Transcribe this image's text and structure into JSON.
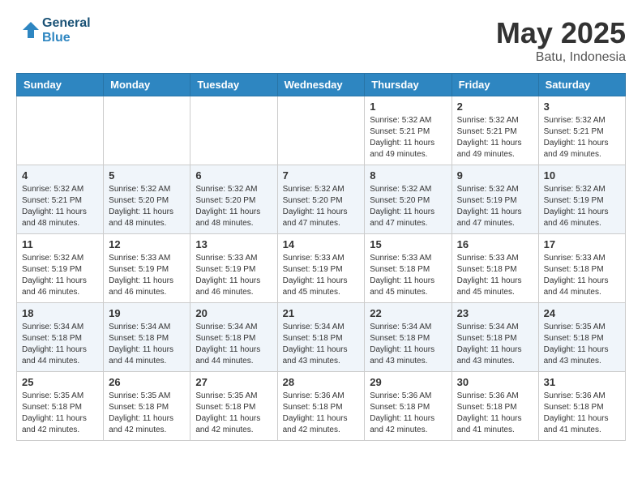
{
  "header": {
    "logo_line1": "General",
    "logo_line2": "Blue",
    "month": "May 2025",
    "location": "Batu, Indonesia"
  },
  "weekdays": [
    "Sunday",
    "Monday",
    "Tuesday",
    "Wednesday",
    "Thursday",
    "Friday",
    "Saturday"
  ],
  "weeks": [
    [
      {
        "day": "",
        "info": ""
      },
      {
        "day": "",
        "info": ""
      },
      {
        "day": "",
        "info": ""
      },
      {
        "day": "",
        "info": ""
      },
      {
        "day": "1",
        "info": "Sunrise: 5:32 AM\nSunset: 5:21 PM\nDaylight: 11 hours\nand 49 minutes."
      },
      {
        "day": "2",
        "info": "Sunrise: 5:32 AM\nSunset: 5:21 PM\nDaylight: 11 hours\nand 49 minutes."
      },
      {
        "day": "3",
        "info": "Sunrise: 5:32 AM\nSunset: 5:21 PM\nDaylight: 11 hours\nand 49 minutes."
      }
    ],
    [
      {
        "day": "4",
        "info": "Sunrise: 5:32 AM\nSunset: 5:21 PM\nDaylight: 11 hours\nand 48 minutes."
      },
      {
        "day": "5",
        "info": "Sunrise: 5:32 AM\nSunset: 5:20 PM\nDaylight: 11 hours\nand 48 minutes."
      },
      {
        "day": "6",
        "info": "Sunrise: 5:32 AM\nSunset: 5:20 PM\nDaylight: 11 hours\nand 48 minutes."
      },
      {
        "day": "7",
        "info": "Sunrise: 5:32 AM\nSunset: 5:20 PM\nDaylight: 11 hours\nand 47 minutes."
      },
      {
        "day": "8",
        "info": "Sunrise: 5:32 AM\nSunset: 5:20 PM\nDaylight: 11 hours\nand 47 minutes."
      },
      {
        "day": "9",
        "info": "Sunrise: 5:32 AM\nSunset: 5:19 PM\nDaylight: 11 hours\nand 47 minutes."
      },
      {
        "day": "10",
        "info": "Sunrise: 5:32 AM\nSunset: 5:19 PM\nDaylight: 11 hours\nand 46 minutes."
      }
    ],
    [
      {
        "day": "11",
        "info": "Sunrise: 5:32 AM\nSunset: 5:19 PM\nDaylight: 11 hours\nand 46 minutes."
      },
      {
        "day": "12",
        "info": "Sunrise: 5:33 AM\nSunset: 5:19 PM\nDaylight: 11 hours\nand 46 minutes."
      },
      {
        "day": "13",
        "info": "Sunrise: 5:33 AM\nSunset: 5:19 PM\nDaylight: 11 hours\nand 46 minutes."
      },
      {
        "day": "14",
        "info": "Sunrise: 5:33 AM\nSunset: 5:19 PM\nDaylight: 11 hours\nand 45 minutes."
      },
      {
        "day": "15",
        "info": "Sunrise: 5:33 AM\nSunset: 5:18 PM\nDaylight: 11 hours\nand 45 minutes."
      },
      {
        "day": "16",
        "info": "Sunrise: 5:33 AM\nSunset: 5:18 PM\nDaylight: 11 hours\nand 45 minutes."
      },
      {
        "day": "17",
        "info": "Sunrise: 5:33 AM\nSunset: 5:18 PM\nDaylight: 11 hours\nand 44 minutes."
      }
    ],
    [
      {
        "day": "18",
        "info": "Sunrise: 5:34 AM\nSunset: 5:18 PM\nDaylight: 11 hours\nand 44 minutes."
      },
      {
        "day": "19",
        "info": "Sunrise: 5:34 AM\nSunset: 5:18 PM\nDaylight: 11 hours\nand 44 minutes."
      },
      {
        "day": "20",
        "info": "Sunrise: 5:34 AM\nSunset: 5:18 PM\nDaylight: 11 hours\nand 44 minutes."
      },
      {
        "day": "21",
        "info": "Sunrise: 5:34 AM\nSunset: 5:18 PM\nDaylight: 11 hours\nand 43 minutes."
      },
      {
        "day": "22",
        "info": "Sunrise: 5:34 AM\nSunset: 5:18 PM\nDaylight: 11 hours\nand 43 minutes."
      },
      {
        "day": "23",
        "info": "Sunrise: 5:34 AM\nSunset: 5:18 PM\nDaylight: 11 hours\nand 43 minutes."
      },
      {
        "day": "24",
        "info": "Sunrise: 5:35 AM\nSunset: 5:18 PM\nDaylight: 11 hours\nand 43 minutes."
      }
    ],
    [
      {
        "day": "25",
        "info": "Sunrise: 5:35 AM\nSunset: 5:18 PM\nDaylight: 11 hours\nand 42 minutes."
      },
      {
        "day": "26",
        "info": "Sunrise: 5:35 AM\nSunset: 5:18 PM\nDaylight: 11 hours\nand 42 minutes."
      },
      {
        "day": "27",
        "info": "Sunrise: 5:35 AM\nSunset: 5:18 PM\nDaylight: 11 hours\nand 42 minutes."
      },
      {
        "day": "28",
        "info": "Sunrise: 5:36 AM\nSunset: 5:18 PM\nDaylight: 11 hours\nand 42 minutes."
      },
      {
        "day": "29",
        "info": "Sunrise: 5:36 AM\nSunset: 5:18 PM\nDaylight: 11 hours\nand 42 minutes."
      },
      {
        "day": "30",
        "info": "Sunrise: 5:36 AM\nSunset: 5:18 PM\nDaylight: 11 hours\nand 41 minutes."
      },
      {
        "day": "31",
        "info": "Sunrise: 5:36 AM\nSunset: 5:18 PM\nDaylight: 11 hours\nand 41 minutes."
      }
    ]
  ]
}
